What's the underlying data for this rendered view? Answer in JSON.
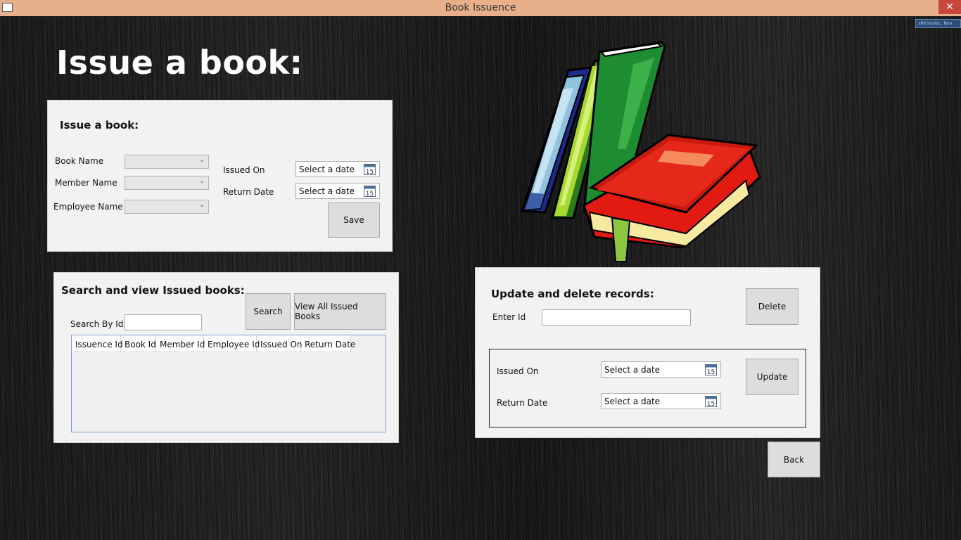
{
  "window": {
    "title": "Book Issuence",
    "close_glyph": "✕"
  },
  "tray": {
    "text": "x86 hooks.. fere"
  },
  "page_title": "Issue a book:",
  "issue_panel": {
    "title": "Issue a book:",
    "book_name_label": "Book Name",
    "member_name_label": "Member Name",
    "employee_name_label": "Employee Name",
    "issued_on_label": "Issued On",
    "return_date_label": "Return Date",
    "issued_on_value": "Select a date",
    "return_date_value": "Select a date",
    "save_label": "Save"
  },
  "search_panel": {
    "title": "Search and view Issued books:",
    "search_label": "Search",
    "view_all_label": "View All Issued Books",
    "search_by_id_label": "Search By Id:",
    "columns": [
      "Issuence Id",
      "Book Id",
      "Member Id",
      "Employee Id",
      "Issued On",
      "Return Date"
    ]
  },
  "update_panel": {
    "title": "Update and delete records:",
    "enter_id_label": "Enter Id",
    "delete_label": "Delete",
    "issued_on_label": "Issued On",
    "return_date_label": "Return Date",
    "issued_on_value": "Select a date",
    "return_date_value": "Select a date",
    "update_label": "Update"
  },
  "back_label": "Back",
  "calendar_day": "15",
  "icons": {
    "calendar": "calendar-icon",
    "dropdown": "chevron-down-icon",
    "books": "books-illustration"
  }
}
